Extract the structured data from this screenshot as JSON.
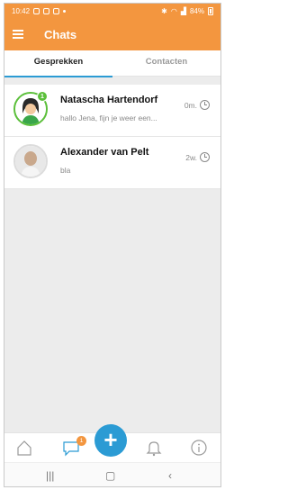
{
  "status_bar": {
    "time": "10:42",
    "battery": "84%"
  },
  "app_bar": {
    "title": "Chats"
  },
  "tabs": [
    {
      "label": "Gesprekken",
      "active": true
    },
    {
      "label": "Contacten",
      "active": false
    }
  ],
  "chats": [
    {
      "name": "Natascha Hartendorf",
      "preview": "hallo Jena, fijn je weer een...",
      "time": "0m.",
      "unread": "1"
    },
    {
      "name": "Alexander van Pelt",
      "preview": "bla",
      "time": "2w."
    }
  ],
  "bottom_nav": {
    "chat_badge": "1",
    "fab_label": "+"
  },
  "colors": {
    "accent": "#f3963f",
    "primary": "#2b9bd4",
    "online": "#5bbf3a"
  }
}
